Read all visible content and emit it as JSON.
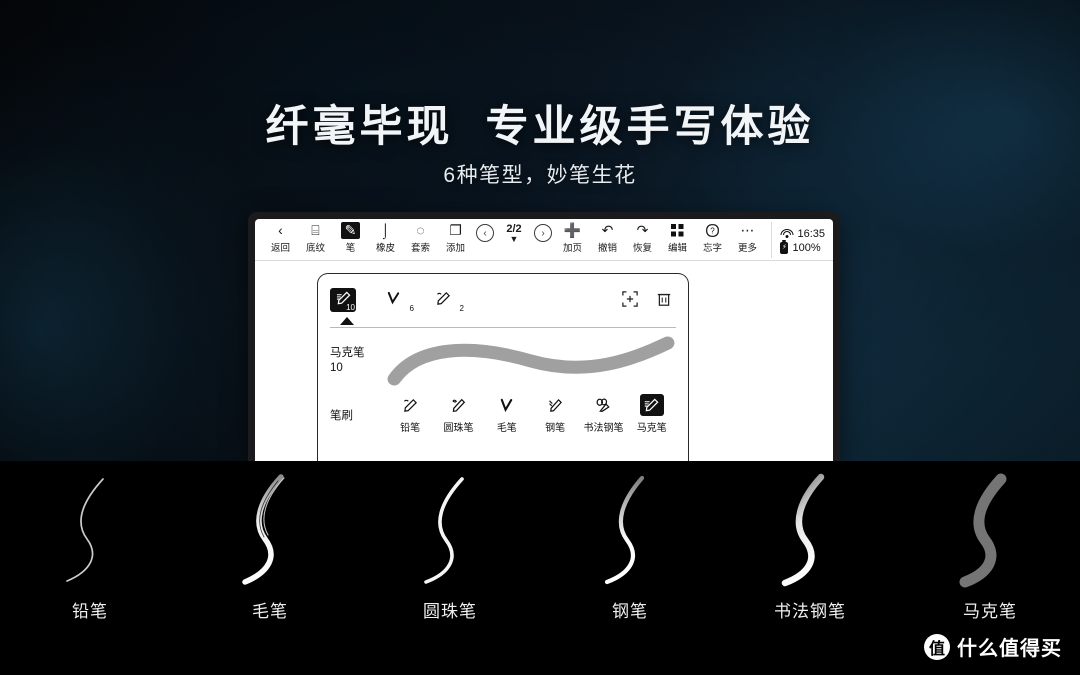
{
  "hero": {
    "headline": "纤毫毕现  专业级手写体验",
    "subhead": "6种笔型，妙笔生花",
    "bg_left": "#06090d",
    "bg_right": "#123043"
  },
  "tablet": {
    "toolbar": {
      "left_items": [
        {
          "label": "返回",
          "icon": "back-chevron-icon",
          "glyph": "‹",
          "selected": false
        },
        {
          "label": "底纹",
          "icon": "texture-icon",
          "glyph": "⌸",
          "selected": false
        },
        {
          "label": "笔",
          "icon": "pen-icon",
          "glyph": "✎",
          "selected": true
        },
        {
          "label": "橡皮",
          "icon": "eraser-icon",
          "glyph": "⌡",
          "selected": false
        },
        {
          "label": "套索",
          "icon": "lasso-icon",
          "glyph": "◌",
          "selected": false
        },
        {
          "label": "添加",
          "icon": "add-shape-icon",
          "glyph": "❐",
          "selected": false
        }
      ],
      "page_nav": {
        "prev_icon": "prev-page-icon",
        "prev_glyph": "‹",
        "count": "2/2",
        "dropdown_glyph": "▼",
        "next_icon": "next-page-icon",
        "next_glyph": "›"
      },
      "right_items": [
        {
          "label": "加页",
          "icon": "add-page-icon",
          "glyph": "➕",
          "selected": false
        },
        {
          "label": "撤销",
          "icon": "undo-icon",
          "glyph": "↶",
          "selected": false
        },
        {
          "label": "恢复",
          "icon": "redo-icon",
          "glyph": "↷",
          "selected": false
        },
        {
          "label": "编辑",
          "icon": "grid-edit-icon",
          "glyph": "░",
          "selected": false
        },
        {
          "label": "忘字",
          "icon": "word-help-icon",
          "glyph": "⍰",
          "selected": false
        },
        {
          "label": "更多",
          "icon": "more-icon",
          "glyph": "⋯",
          "selected": false
        }
      ],
      "status": {
        "wifi_icon": "wifi-icon",
        "time": "16:35",
        "battery_icon": "battery-icon",
        "battery": "100%"
      }
    },
    "pen_card": {
      "presets": [
        {
          "icon": "marker-pen-icon",
          "glyph": "✎",
          "size": "10",
          "selected": true
        },
        {
          "icon": "brush-pen-icon",
          "glyph": "✓",
          "size": "6",
          "selected": false
        },
        {
          "icon": "pencil-icon",
          "glyph": "✏",
          "size": "2",
          "selected": false
        }
      ],
      "actions": [
        {
          "icon": "add-preset-icon",
          "glyph": "⧉"
        },
        {
          "icon": "delete-preset-icon",
          "glyph": "🗑"
        }
      ],
      "preview": {
        "name": "马克笔",
        "size": "10",
        "stroke_color": "#a0a0a0"
      },
      "brush_label": "笔刷",
      "brushes": [
        {
          "label": "铅笔",
          "icon": "pencil-icon",
          "glyph": "✏",
          "selected": false
        },
        {
          "label": "圆珠笔",
          "icon": "ballpoint-pen-icon",
          "glyph": "✒",
          "selected": false
        },
        {
          "label": "毛笔",
          "icon": "calligraphy-brush-icon",
          "glyph": "✓",
          "selected": false
        },
        {
          "label": "钢笔",
          "icon": "fountain-pen-icon",
          "glyph": "✑",
          "selected": false
        },
        {
          "label": "书法钢笔",
          "icon": "calligraphy-pen-icon",
          "glyph": "œ",
          "selected": false
        },
        {
          "label": "马克笔",
          "icon": "marker-pen-icon",
          "glyph": "✎",
          "selected": true
        }
      ]
    }
  },
  "showcase": {
    "pens": [
      {
        "label": "铅笔",
        "style": "pencil",
        "color": "#e8e8e8",
        "width": 1.6
      },
      {
        "label": "毛笔",
        "style": "brush",
        "color": "#ffffff",
        "width": 6
      },
      {
        "label": "圆珠笔",
        "style": "ballpoint",
        "color": "#ffffff",
        "width": 4
      },
      {
        "label": "钢笔",
        "style": "fountain",
        "color": "#ffffff",
        "width": 3.5
      },
      {
        "label": "书法钢笔",
        "style": "calligraphy",
        "color": "#ffffff",
        "width": 7
      },
      {
        "label": "马克笔",
        "style": "marker",
        "color": "#8a8a8a",
        "width": 11
      }
    ]
  },
  "watermark": {
    "logo": "值",
    "text": "什么值得买"
  }
}
